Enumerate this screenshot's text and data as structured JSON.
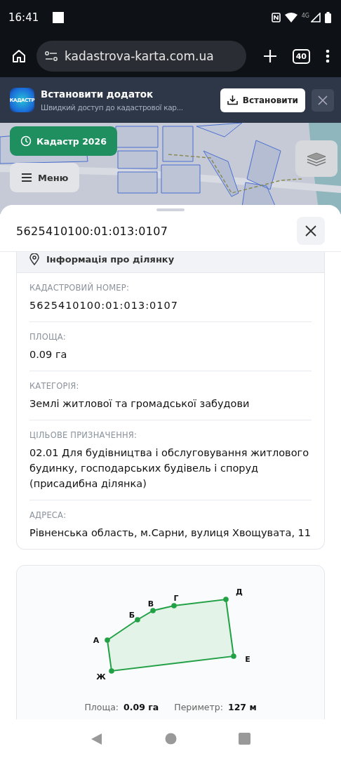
{
  "status_bar": {
    "time": "16:41",
    "network": "4G"
  },
  "browser": {
    "url": "kadastrova-karta.com.ua",
    "tab_count": "40"
  },
  "install_banner": {
    "title": "Встановити додаток",
    "subtitle": "Швидкий доступ до кадастрової кар...",
    "logo_text": "КАДАСТР",
    "button": "Встановити"
  },
  "map": {
    "year_button": "Кадастр 2026",
    "menu_button": "Меню"
  },
  "sheet": {
    "title": "5625410100:01:013:0107",
    "info_header": "Інформація про ділянку",
    "fields": [
      {
        "label": "КАДАСТРОВИЙ НОМЕР:",
        "value": "5625410100:01:013:0107"
      },
      {
        "label": "ПЛОЩА:",
        "value": "0.09 га"
      },
      {
        "label": "КАТЕГОРІЯ:",
        "value": "Землі житлової та громадської забудови"
      },
      {
        "label": "ЦІЛЬОВЕ ПРИЗНАЧЕННЯ:",
        "value": "02.01 Для будівництва і обслуговування житлового будинку, господарських будівель і споруд (присадибна ділянка)"
      },
      {
        "label": "АДРЕСА:",
        "value": "Рівненська область, м.Сарни, вулиця Хвощувата, 11"
      }
    ],
    "plot": {
      "vertices": [
        "А",
        "Б",
        "В",
        "Г",
        "Д",
        "Е",
        "Ж"
      ],
      "stats": [
        {
          "label": "Площа:",
          "value": "0.09 га"
        },
        {
          "label": "Периметр:",
          "value": "127 м"
        }
      ]
    }
  }
}
